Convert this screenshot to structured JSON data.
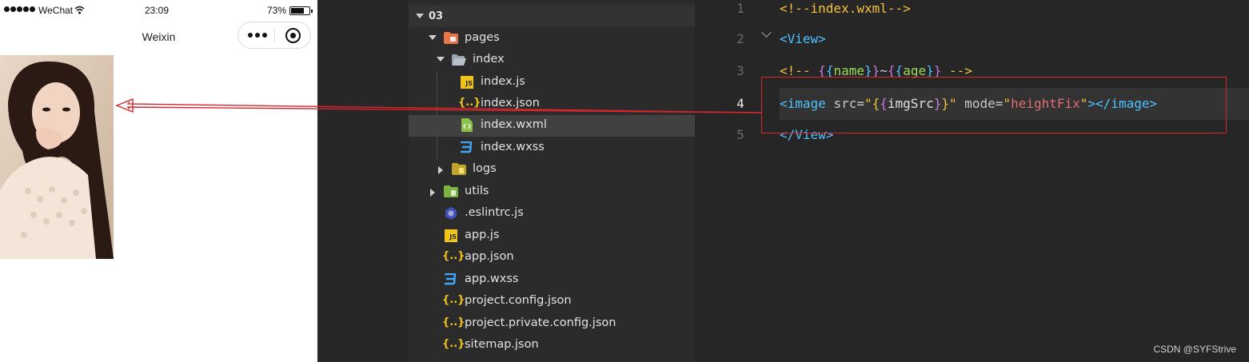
{
  "status_bar": {
    "carrier": "WeChat",
    "time": "23:09",
    "battery": "73%",
    "battery_level": 0.73
  },
  "nav": {
    "title": "Weixin"
  },
  "explorer": {
    "project": "03",
    "rows": [
      {
        "label": "pages",
        "icon": "folder-pages-icon"
      },
      {
        "label": "index",
        "icon": "folder-open-icon"
      },
      {
        "label": "index.js",
        "icon": "js-file-icon"
      },
      {
        "label": "index.json",
        "icon": "json-file-icon"
      },
      {
        "label": "index.wxml",
        "icon": "wxml-file-icon"
      },
      {
        "label": "index.wxss",
        "icon": "wxss-file-icon"
      },
      {
        "label": "logs",
        "icon": "folder-icon"
      },
      {
        "label": "utils",
        "icon": "folder-utils-icon"
      },
      {
        "label": ".eslintrc.js",
        "icon": "eslint-file-icon"
      },
      {
        "label": "app.js",
        "icon": "js-file-icon"
      },
      {
        "label": "app.json",
        "icon": "json-file-icon"
      },
      {
        "label": "app.wxss",
        "icon": "wxss-file-icon"
      },
      {
        "label": "project.config.json",
        "icon": "json-file-icon"
      },
      {
        "label": "project.private.config.json",
        "icon": "json-file-icon"
      },
      {
        "label": "sitemap.json",
        "icon": "json-file-icon"
      }
    ]
  },
  "editor": {
    "line_numbers": [
      "1",
      "2",
      "3",
      "4",
      "5"
    ],
    "current_line": "4",
    "tokens": {
      "l1_comment": "<!--index.wxml-->",
      "lt": "<",
      "gt": ">",
      "lt_slash": "</",
      "view": "View",
      "l3_open": "<!-- ",
      "lbrace": "{",
      "rbrace": "}",
      "name": "name",
      "tilde": "~",
      "age": "age",
      "l3_close": " -->",
      "image": "image",
      "src_attr": " src=",
      "quote": "\"",
      "imgSrc": "imgSrc",
      "mode_attr": " mode=",
      "mode_value": "heightFix"
    }
  },
  "watermark": "CSDN @SYFStrive",
  "colors": {
    "annotation": "#d9262d",
    "folder_orange": "#e8764a",
    "folder_green": "#8bc34a",
    "js_yellow": "#f0c419",
    "json_yellow": "#f0c419",
    "wxss_blue": "#42a5f5",
    "eslint_purple": "#5c6bc0"
  }
}
